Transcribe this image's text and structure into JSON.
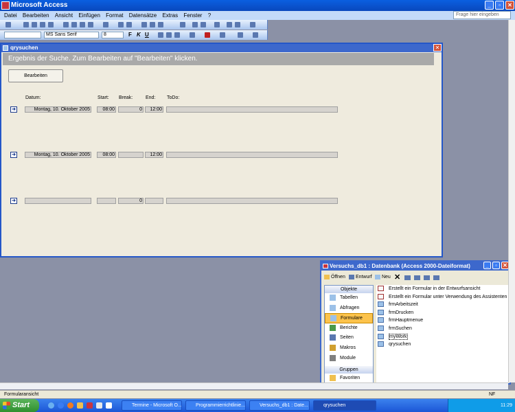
{
  "app": {
    "title": "Microsoft Access",
    "help_placeholder": "Frage hier eingeben"
  },
  "menu": [
    "Datei",
    "Bearbeiten",
    "Ansicht",
    "Einfügen",
    "Format",
    "Datensätze",
    "Extras",
    "Fenster",
    "?"
  ],
  "format_bar": {
    "font": "MS Sans Serif",
    "size": "8",
    "bold": "F",
    "italic": "K",
    "underline": "U"
  },
  "form": {
    "title": "qrysuchen",
    "header": "Ergebnis der Suche. Zum Bearbeiten auf \"Bearbeiten\" klicken.",
    "edit_button": "Bearbeiten",
    "columns": {
      "datum": "Datum:",
      "start": "Start:",
      "break": "Break:",
      "end": "End:",
      "todo": "ToDo:"
    },
    "records": [
      {
        "datum": "Montag, 10. Oktober 2005",
        "start": "08:00",
        "break": "0",
        "end": "12:00",
        "todo": ""
      },
      {
        "datum": "Montag, 10. Oktober 2005",
        "start": "08:00",
        "break": "",
        "end": "12:00",
        "todo": ""
      },
      {
        "datum": "",
        "start": "",
        "break": "0",
        "end": "",
        "todo": ""
      }
    ]
  },
  "db_window": {
    "title": "Versuchs_db1 : Datenbank (Access 2000-Dateiformat)",
    "toolbar": {
      "open": "Öffnen",
      "design": "Entwurf",
      "new": "Neu"
    },
    "objects_header": "Objekte",
    "objects": [
      "Tabellen",
      "Abfragen",
      "Formulare",
      "Berichte",
      "Seiten",
      "Makros",
      "Module"
    ],
    "selected_object": "Formulare",
    "groups_header": "Gruppen",
    "groups": [
      "Favoriten"
    ],
    "items": [
      "Erstellt ein Formular in der Entwurfsansicht",
      "Erstellt ein Formular unter Verwendung des Assistenten",
      "frmArbeitszeit",
      "frmDrucken",
      "frmHauptmenue",
      "frmSuchen",
      "myWork",
      "qrysuchen"
    ]
  },
  "status": {
    "mode": "Formularansicht",
    "indicator": "NF"
  },
  "taskbar": {
    "start": "Start",
    "tasks": [
      "Termine - Microsoft O...",
      "Programmierrichtlinie...",
      "Versuchs_db1 : Date...",
      "qrysuchen"
    ],
    "clock": "11:29"
  },
  "colors": {
    "xp_blue": "#0a5fe0",
    "form_bg": "#efebde",
    "header_band": "#a9a9a9",
    "selected": "#fcc34c"
  }
}
